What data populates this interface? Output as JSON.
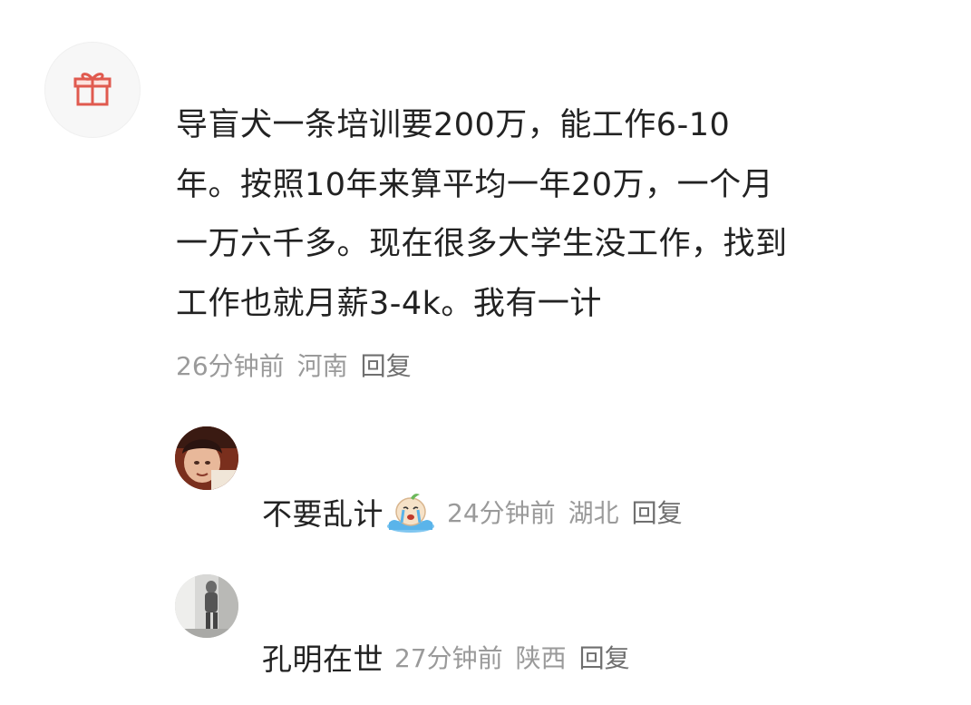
{
  "comment": {
    "avatar_icon": "gift-icon",
    "lines": [
      "导盲犬一条培训要200万，能工作6-10",
      "年。按照10年来算平均一年20万，一个月",
      "一万六千多。现在很多大学生没工作，找到",
      "工作也就月薪3-4k。我有一计"
    ],
    "time": "26分钟前",
    "location": "河南",
    "reply_label": "回复"
  },
  "replies": [
    {
      "text": "不要乱计",
      "emoji": "crying-emoji",
      "time": "24分钟前",
      "location": "湖北",
      "reply_label": "回复"
    },
    {
      "text": "孔明在世",
      "time": "27分钟前",
      "location": "陕西",
      "reply_label": "回复"
    }
  ],
  "colors": {
    "gift_red": "#e05a4f",
    "meta_gray": "#9a9a9a",
    "text_dark": "#222222"
  }
}
